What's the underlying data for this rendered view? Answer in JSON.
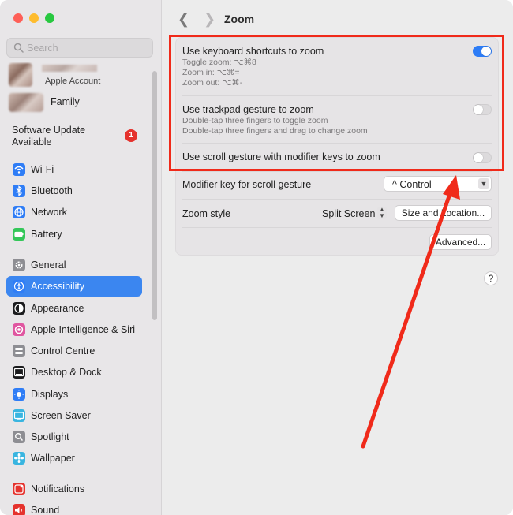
{
  "search": {
    "placeholder": "Search"
  },
  "account": {
    "apple_account_label": "Apple Account",
    "family_label": "Family"
  },
  "software_update": {
    "label": "Software Update Available",
    "badge": "1"
  },
  "sidebar": {
    "items": [
      {
        "label": "Wi-Fi",
        "color": "#2f7df6",
        "icon": "wifi-icon"
      },
      {
        "label": "Bluetooth",
        "color": "#2f7df6",
        "icon": "bluetooth-icon"
      },
      {
        "label": "Network",
        "color": "#2f7df6",
        "icon": "globe-icon"
      },
      {
        "label": "Battery",
        "color": "#34c759",
        "icon": "battery-icon"
      },
      {
        "label": "General",
        "color": "#8e8e93",
        "icon": "gear-icon"
      },
      {
        "label": "Accessibility",
        "color": "#2f7df6",
        "icon": "accessibility-icon",
        "selected": true
      },
      {
        "label": "Appearance",
        "color": "#1c1c1e",
        "icon": "appearance-icon"
      },
      {
        "label": "Apple Intelligence & Siri",
        "color": "#e056a0",
        "icon": "siri-icon"
      },
      {
        "label": "Control Centre",
        "color": "#8e8e93",
        "icon": "control-centre-icon"
      },
      {
        "label": "Desktop & Dock",
        "color": "#1c1c1e",
        "icon": "dock-icon"
      },
      {
        "label": "Displays",
        "color": "#2f7df6",
        "icon": "display-icon"
      },
      {
        "label": "Screen Saver",
        "color": "#39b5e0",
        "icon": "screen-saver-icon"
      },
      {
        "label": "Spotlight",
        "color": "#8e8e93",
        "icon": "spotlight-icon"
      },
      {
        "label": "Wallpaper",
        "color": "#39b5e0",
        "icon": "wallpaper-icon"
      },
      {
        "label": "Notifications",
        "color": "#e5322d",
        "icon": "notifications-icon"
      },
      {
        "label": "Sound",
        "color": "#e5322d",
        "icon": "sound-icon"
      }
    ]
  },
  "header": {
    "title": "Zoom"
  },
  "zoom": {
    "keyboard": {
      "title": "Use keyboard shortcuts to zoom",
      "toggle_zoom": "Toggle zoom: ⌥⌘8",
      "zoom_in": "Zoom in: ⌥⌘=",
      "zoom_out": "Zoom out: ⌥⌘-",
      "enabled": true
    },
    "trackpad": {
      "title": "Use trackpad gesture to zoom",
      "line1": "Double-tap three fingers to toggle zoom",
      "line2": "Double-tap three fingers and drag to change zoom",
      "enabled": false
    },
    "scroll": {
      "title": "Use scroll gesture with modifier keys to zoom",
      "enabled": false
    },
    "modifier": {
      "label": "Modifier key for scroll gesture",
      "value": "^ Control"
    },
    "style": {
      "label": "Zoom style",
      "value": "Split Screen",
      "size_button": "Size and Location..."
    },
    "advanced_button": "Advanced...",
    "help": "?"
  },
  "accent_color": "#2d7cf6",
  "annotation_color": "#f02a1a"
}
